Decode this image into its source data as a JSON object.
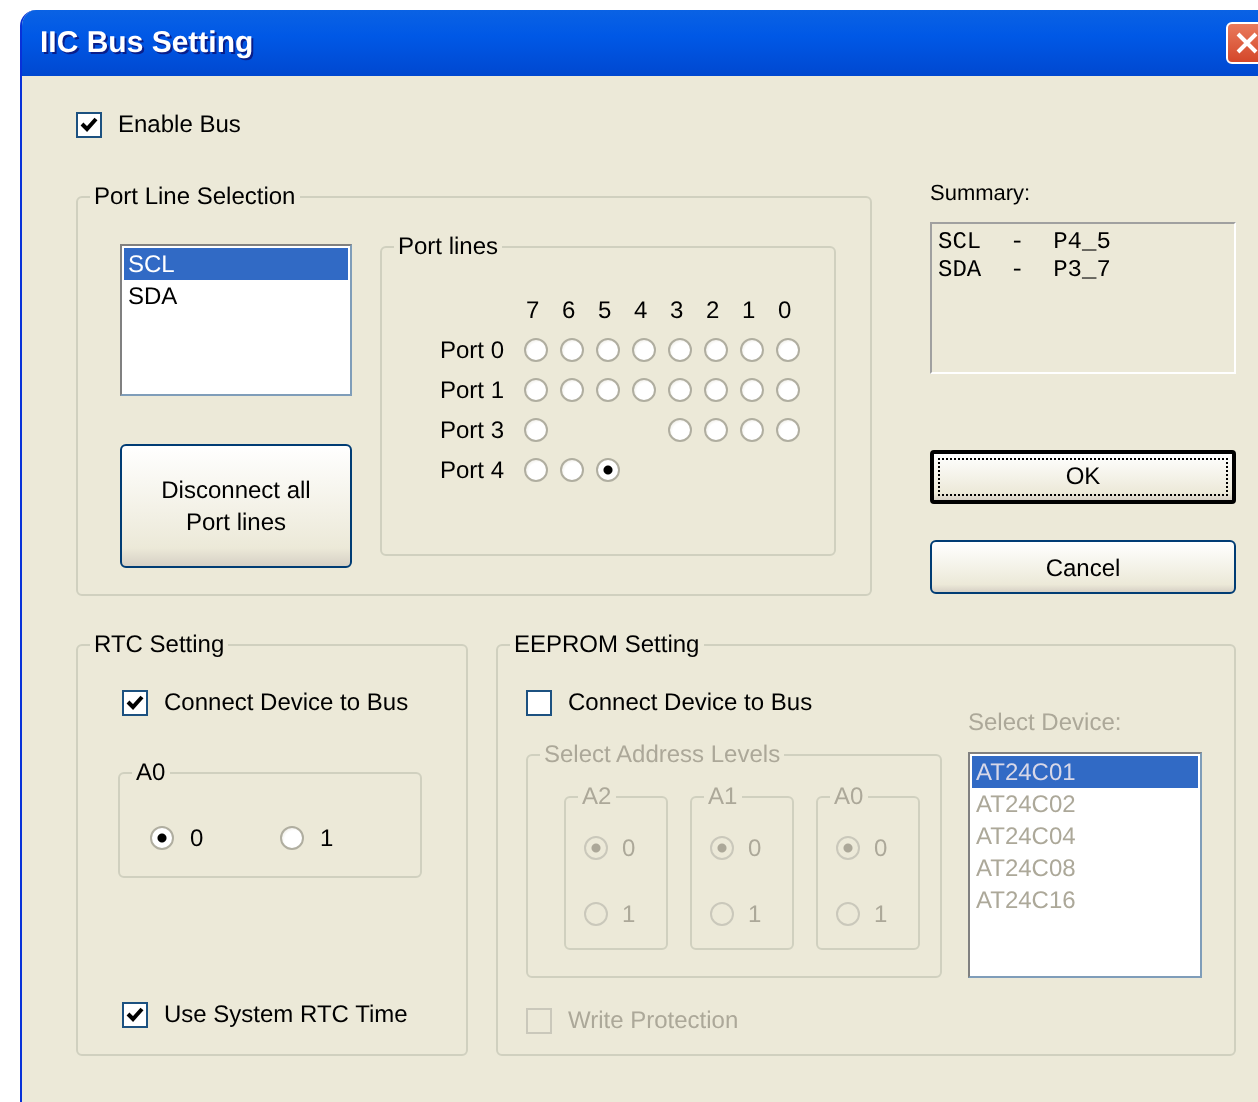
{
  "window": {
    "title": "IIC Bus Setting"
  },
  "enable_bus": {
    "label": "Enable Bus",
    "checked": true
  },
  "port_line_selection": {
    "title": "Port Line Selection",
    "lines": [
      {
        "label": "SCL",
        "selected": true
      },
      {
        "label": "SDA",
        "selected": false
      }
    ],
    "disconnect_button": "Disconnect all Port lines",
    "port_lines": {
      "title": "Port lines",
      "bits": [
        "7",
        "6",
        "5",
        "4",
        "3",
        "2",
        "1",
        "0"
      ],
      "ports": [
        {
          "label": "Port 0",
          "lines": [
            {
              "kind": "radio",
              "selected": false
            },
            {
              "kind": "radio",
              "selected": false
            },
            {
              "kind": "radio",
              "selected": false
            },
            {
              "kind": "radio",
              "selected": false
            },
            {
              "kind": "radio",
              "selected": false
            },
            {
              "kind": "radio",
              "selected": false
            },
            {
              "kind": "radio",
              "selected": false
            },
            {
              "kind": "radio",
              "selected": false
            }
          ]
        },
        {
          "label": "Port 1",
          "lines": [
            {
              "kind": "radio",
              "selected": false
            },
            {
              "kind": "radio",
              "selected": false
            },
            {
              "kind": "radio",
              "selected": false
            },
            {
              "kind": "radio",
              "selected": false
            },
            {
              "kind": "radio",
              "selected": false
            },
            {
              "kind": "radio",
              "selected": false
            },
            {
              "kind": "radio",
              "selected": false
            },
            {
              "kind": "radio",
              "selected": false
            }
          ]
        },
        {
          "label": "Port 3",
          "lines": [
            {
              "kind": "radio",
              "selected": false
            },
            {
              "kind": "gap"
            },
            {
              "kind": "gap"
            },
            {
              "kind": "gap"
            },
            {
              "kind": "radio",
              "selected": false
            },
            {
              "kind": "radio",
              "selected": false
            },
            {
              "kind": "radio",
              "selected": false
            },
            {
              "kind": "radio",
              "selected": false
            }
          ]
        },
        {
          "label": "Port 4",
          "lines": [
            {
              "kind": "radio",
              "selected": false
            },
            {
              "kind": "radio",
              "selected": false
            },
            {
              "kind": "radio",
              "selected": true
            }
          ]
        }
      ]
    }
  },
  "summary": {
    "label": "Summary:",
    "lines": [
      "SCL  -  P4_5",
      "SDA  -  P3_7"
    ]
  },
  "buttons": [
    {
      "label": "OK",
      "default": true
    },
    {
      "label": "Cancel",
      "default": false
    }
  ],
  "rtc_setting": {
    "title": "RTC Setting",
    "connect": {
      "label": "Connect Device to Bus",
      "checked": true
    },
    "a0": {
      "title": "A0",
      "options": [
        {
          "label": "0",
          "selected": true
        },
        {
          "label": "1",
          "selected": false
        }
      ]
    },
    "use_system_time": {
      "label": "Use System RTC Time",
      "checked": true
    }
  },
  "eeprom_setting": {
    "title": "EEPROM Setting",
    "connect": {
      "label": "Connect Device to Bus",
      "checked": false
    },
    "address_levels": {
      "title": "Select Address Levels",
      "disabled": true,
      "pins": [
        {
          "title": "A2",
          "options": [
            {
              "label": "0",
              "selected": true
            },
            {
              "label": "1",
              "selected": false
            }
          ]
        },
        {
          "title": "A1",
          "options": [
            {
              "label": "0",
              "selected": true
            },
            {
              "label": "1",
              "selected": false
            }
          ]
        },
        {
          "title": "A0",
          "options": [
            {
              "label": "0",
              "selected": true
            },
            {
              "label": "1",
              "selected": false
            }
          ]
        }
      ]
    },
    "device": {
      "label": "Select Device:",
      "disabled": true,
      "items": [
        {
          "label": "AT24C01",
          "selected": true
        },
        {
          "label": "AT24C02",
          "selected": false
        },
        {
          "label": "AT24C04",
          "selected": false
        },
        {
          "label": "AT24C08",
          "selected": false
        },
        {
          "label": "AT24C16",
          "selected": false
        }
      ]
    },
    "write_protection": {
      "label": "Write Protection",
      "checked": false,
      "disabled": true
    }
  }
}
